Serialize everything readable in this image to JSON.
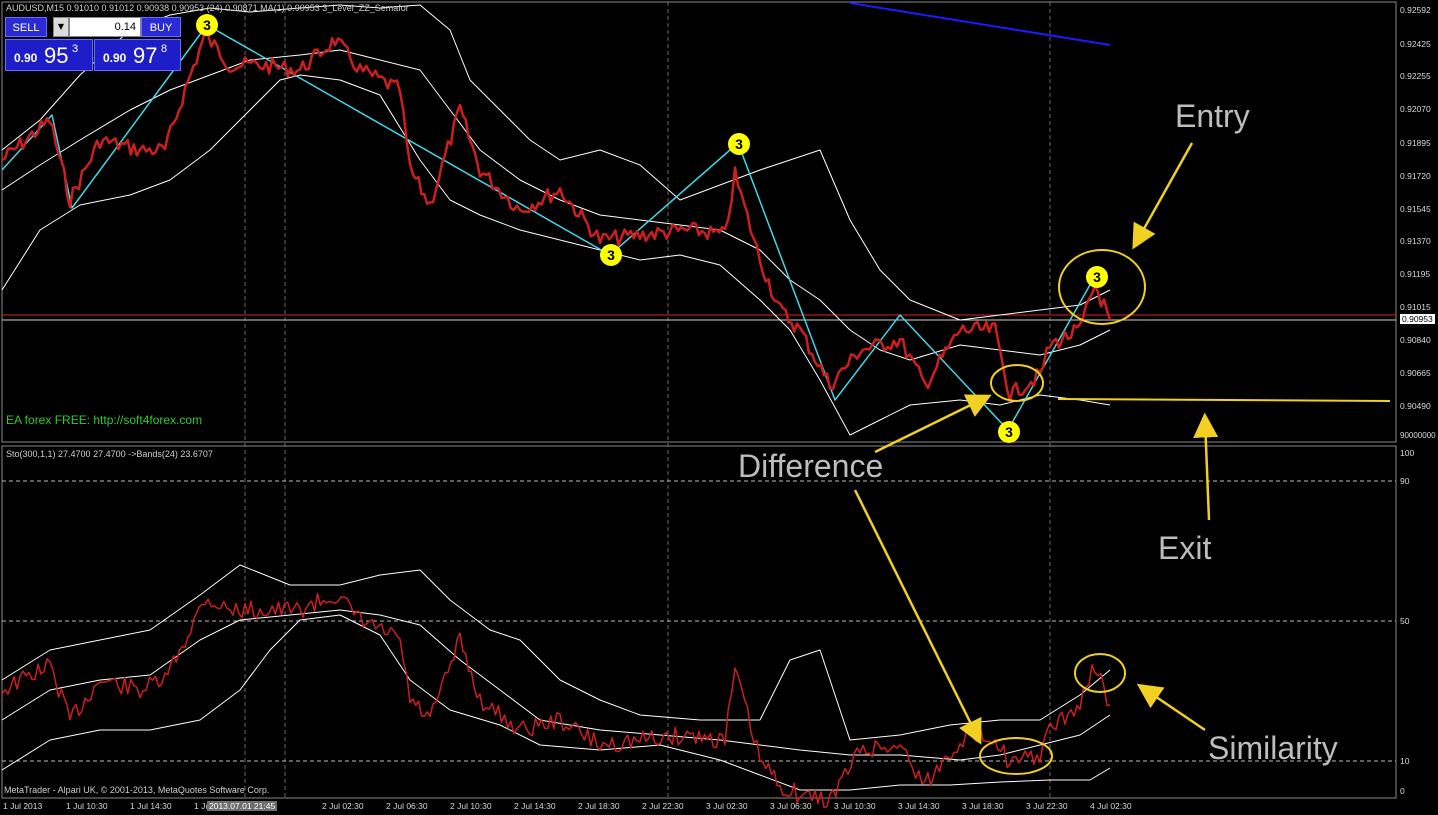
{
  "window": {
    "header_main": "AUDUSD,M15  0.91010 0.91012 0.90938 0.90953 (24) 0.90871  MA(1) 0.90953  3_Level_ZZ_Semafor",
    "header_sub": "Sto(300,1,1) 27.4700 27.4700  ->Bands(24) 23.6707",
    "footer_copyright": "MetaTrader - Alpari UK, © 2001-2013, MetaQuotes Software Corp.",
    "ea_text": "EA forex FREE: http://soft4forex.com"
  },
  "trade_panel": {
    "sell_label": "SELL",
    "buy_label": "BUY",
    "lot_value": "0.14",
    "sell_price_prefix": "0.90",
    "sell_price_big": "95",
    "sell_price_sup": "3",
    "buy_price_prefix": "0.90",
    "buy_price_big": "97",
    "buy_price_sup": "8"
  },
  "price_axis": {
    "labels": [
      "0.92592",
      "0.92425",
      "0.92255",
      "0.92070",
      "0.91895",
      "0.91720",
      "0.91545",
      "0.91370",
      "0.91195",
      "0.91015",
      "0.90953",
      "0.90840",
      "0.90665",
      "0.90490",
      "90000000"
    ],
    "current_price": "0.90953"
  },
  "sto_axis": {
    "labels": [
      "100",
      "90",
      "50",
      "10",
      "0"
    ]
  },
  "time_axis": {
    "labels": [
      "1 Jul 2013",
      "1 Jul 10:30",
      "1 Jul 14:30",
      "1 Jul",
      "2013.07.01 21:45",
      "2 Jul 02:30",
      "2 Jul 06:30",
      "2 Jul 10:30",
      "2 Jul 14:30",
      "2 Jul 18:30",
      "2 Jul 22:30",
      "3 Jul 02:30",
      "3 Jul 06:30",
      "3 Jul 10:30",
      "3 Jul 14:30",
      "3 Jul 18:30",
      "3 Jul 22:30",
      "4 Jul 02:30"
    ]
  },
  "annotations": {
    "entry": "Entry",
    "exit": "Exit",
    "difference": "Difference",
    "similarity": "Similarity"
  },
  "zigzag_marker": "3",
  "colors": {
    "price_line": "#cc1f1f",
    "zigzag": "#3fd8e8",
    "bands": "#ffffff",
    "annotation": "#f0d020",
    "trendline": "#1a1aff",
    "ea_text": "#2ecc2e",
    "marker": "#ffff00"
  }
}
